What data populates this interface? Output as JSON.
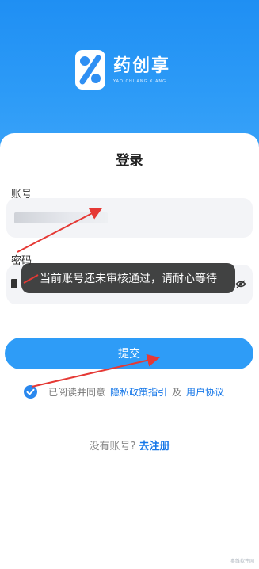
{
  "brand": {
    "name": "药创享",
    "pinyin": "YAO CHUANG XIANG",
    "logo_icon": "yc-logo-icon",
    "header_color": "#1f8ff3"
  },
  "login": {
    "title": "登录",
    "account_label": "账号",
    "password_label": "密码",
    "submit_label": "提交",
    "agree_prefix": "已阅读并同意",
    "privacy_link": "隐私政策指引",
    "and": "及",
    "user_agreement_link": "用户协议",
    "no_account": "没有账号?",
    "register_link": "去注册"
  },
  "toast": {
    "message": "当前账号还未审核通过，请耐心等待"
  },
  "colors": {
    "accent": "#2e9cf7",
    "link": "#1677e8",
    "annotation_arrow": "#e53935"
  },
  "icons": {
    "checkbox": "checked-circle-icon",
    "password_visibility": "eye-off-icon"
  },
  "watermark": "奥维软件网"
}
